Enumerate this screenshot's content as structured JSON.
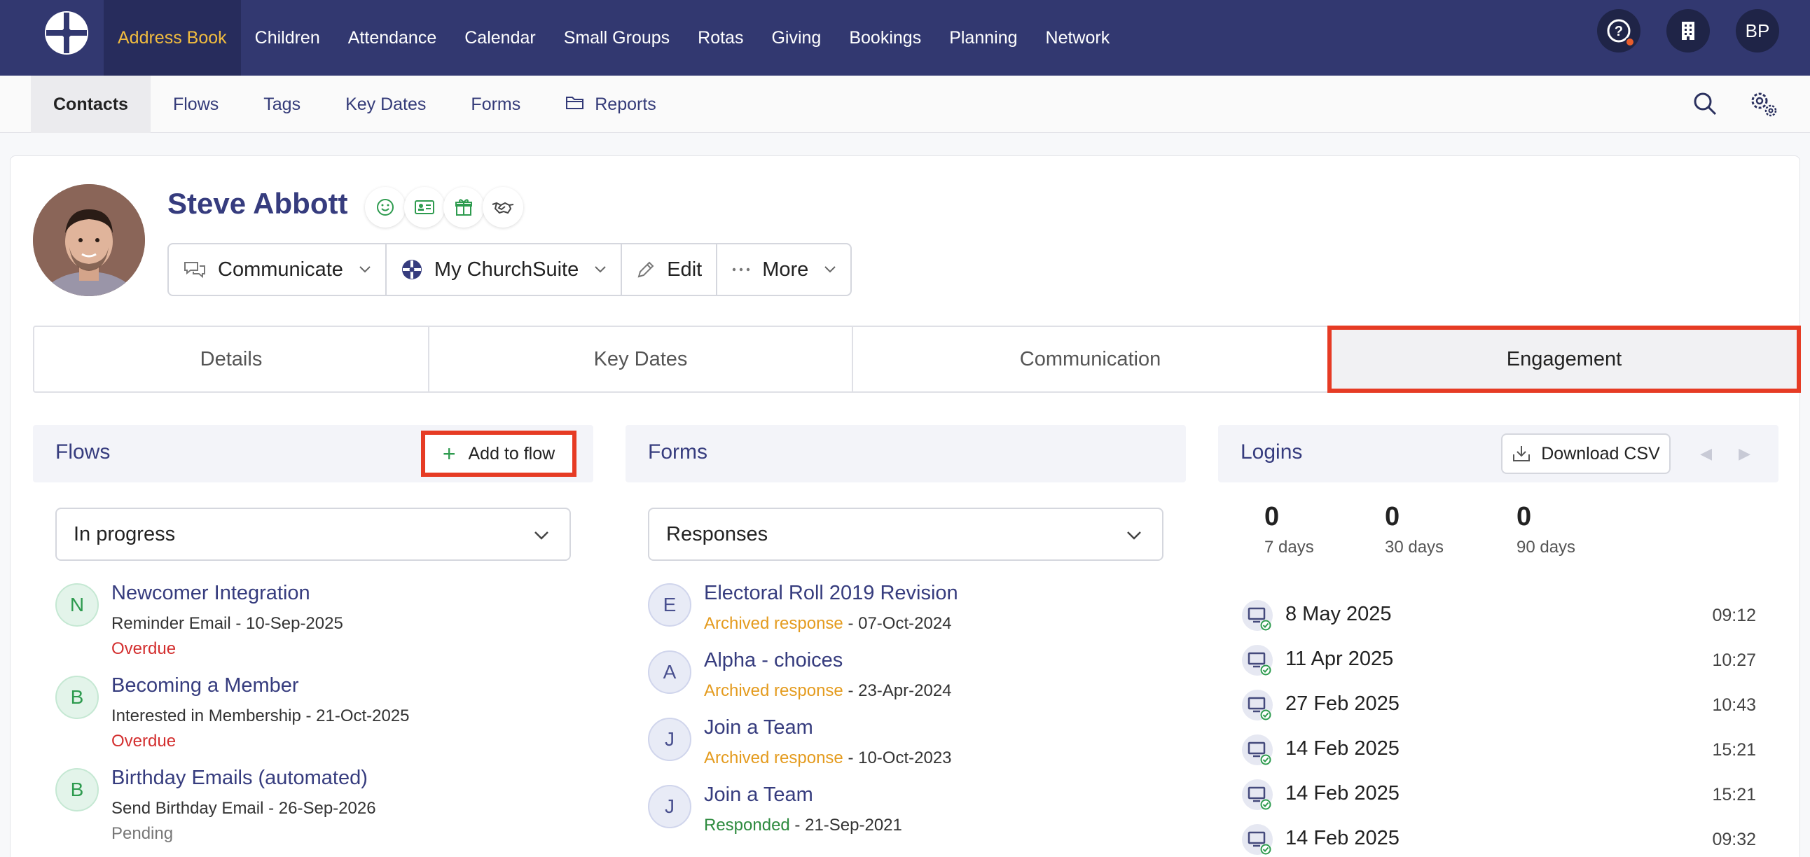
{
  "topnav": {
    "items": [
      {
        "label": "Address Book",
        "active": true
      },
      {
        "label": "Children"
      },
      {
        "label": "Attendance"
      },
      {
        "label": "Calendar"
      },
      {
        "label": "Small Groups"
      },
      {
        "label": "Rotas"
      },
      {
        "label": "Giving"
      },
      {
        "label": "Bookings"
      },
      {
        "label": "Planning"
      },
      {
        "label": "Network"
      }
    ],
    "user_initials": "BP",
    "colors": {
      "bar": "#323870",
      "active_text": "#f1bc3f"
    }
  },
  "subnav": {
    "items": [
      {
        "label": "Contacts",
        "active": true
      },
      {
        "label": "Flows"
      },
      {
        "label": "Tags"
      },
      {
        "label": "Key Dates"
      },
      {
        "label": "Forms"
      },
      {
        "label": "Reports",
        "icon": "folder-icon"
      }
    ]
  },
  "contact": {
    "name": "Steve Abbott",
    "quick_icons": [
      "smile-icon",
      "id-card-icon",
      "gift-icon",
      "handshake-icon"
    ]
  },
  "actions": [
    {
      "label": "Communicate",
      "icon": "chat-icon",
      "dropdown": true
    },
    {
      "label": "My ChurchSuite",
      "icon": "churchsuite-icon",
      "dropdown": true
    },
    {
      "label": "Edit",
      "icon": "pencil-icon",
      "dropdown": false
    },
    {
      "label": "More",
      "icon": "ellipsis-icon",
      "dropdown": true
    }
  ],
  "tabs": [
    {
      "label": "Details"
    },
    {
      "label": "Key Dates"
    },
    {
      "label": "Communication"
    },
    {
      "label": "Engagement",
      "active": true
    }
  ],
  "flows": {
    "title": "Flows",
    "add_label": "Add to flow",
    "filter": "In progress",
    "items": [
      {
        "letter": "N",
        "title": "Newcomer Integration",
        "sub": "Reminder Email - 10-Sep-2025",
        "status": "Overdue",
        "status_color": "red"
      },
      {
        "letter": "B",
        "title": "Becoming a Member",
        "sub": "Interested in Membership - 21-Oct-2025",
        "status": "Overdue",
        "status_color": "red"
      },
      {
        "letter": "B",
        "title": "Birthday Emails (automated)",
        "sub": "Send Birthday Email - 26-Sep-2026",
        "status": "Pending",
        "status_color": "grey"
      }
    ]
  },
  "forms": {
    "title": "Forms",
    "filter": "Responses",
    "items": [
      {
        "letter": "E",
        "title": "Electoral Roll 2019 Revision",
        "status": "Archived response",
        "date": " - 07-Oct-2024",
        "status_color": "orange"
      },
      {
        "letter": "A",
        "title": "Alpha - choices",
        "status": "Archived response",
        "date": " - 23-Apr-2024",
        "status_color": "orange"
      },
      {
        "letter": "J",
        "title": "Join a Team",
        "status": "Archived response",
        "date": " - 10-Oct-2023",
        "status_color": "orange"
      },
      {
        "letter": "J",
        "title": "Join a Team",
        "status": "Responded",
        "date": " - 21-Sep-2021",
        "status_color": "green"
      }
    ]
  },
  "logins": {
    "title": "Logins",
    "download_label": "Download CSV",
    "stats": [
      {
        "value": "0",
        "label": "7 days"
      },
      {
        "value": "0",
        "label": "30 days"
      },
      {
        "value": "0",
        "label": "90 days"
      }
    ],
    "items": [
      {
        "date": "8 May 2025",
        "time": "09:12"
      },
      {
        "date": "11 Apr 2025",
        "time": "10:27"
      },
      {
        "date": "27 Feb 2025",
        "time": "10:43"
      },
      {
        "date": "14 Feb 2025",
        "time": "15:21"
      },
      {
        "date": "14 Feb 2025",
        "time": "15:21"
      },
      {
        "date": "14 Feb 2025",
        "time": "09:32"
      }
    ]
  }
}
